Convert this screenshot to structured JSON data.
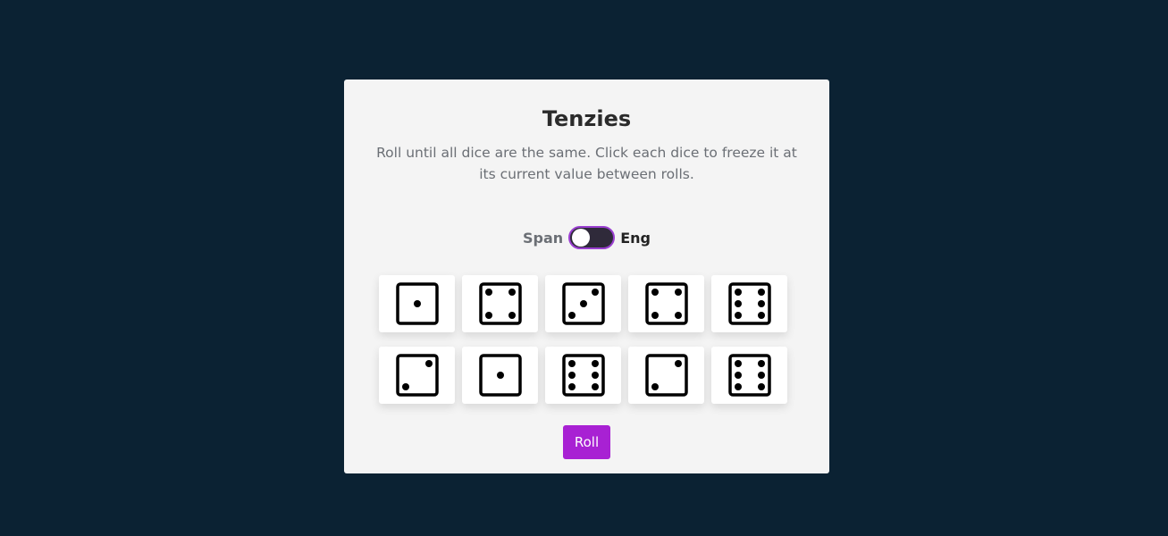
{
  "title": "Tenzies",
  "description": "Roll until all dice are the same. Click each dice to freeze it at its current value between rolls.",
  "language_toggle": {
    "left_label": "Span",
    "right_label": "Eng",
    "selected": "Span"
  },
  "dice": [
    {
      "value": 1,
      "held": false
    },
    {
      "value": 4,
      "held": false
    },
    {
      "value": 3,
      "held": false
    },
    {
      "value": 4,
      "held": false
    },
    {
      "value": 6,
      "held": false
    },
    {
      "value": 2,
      "held": false
    },
    {
      "value": 1,
      "held": false
    },
    {
      "value": 6,
      "held": false
    },
    {
      "value": 2,
      "held": false
    },
    {
      "value": 6,
      "held": false
    }
  ],
  "roll_button": {
    "label": "Roll"
  },
  "colors": {
    "background": "#0b2233",
    "card": "#f4f4f4",
    "accent": "#a821d3",
    "die_face": "#ffffff",
    "pip": "#000000"
  }
}
